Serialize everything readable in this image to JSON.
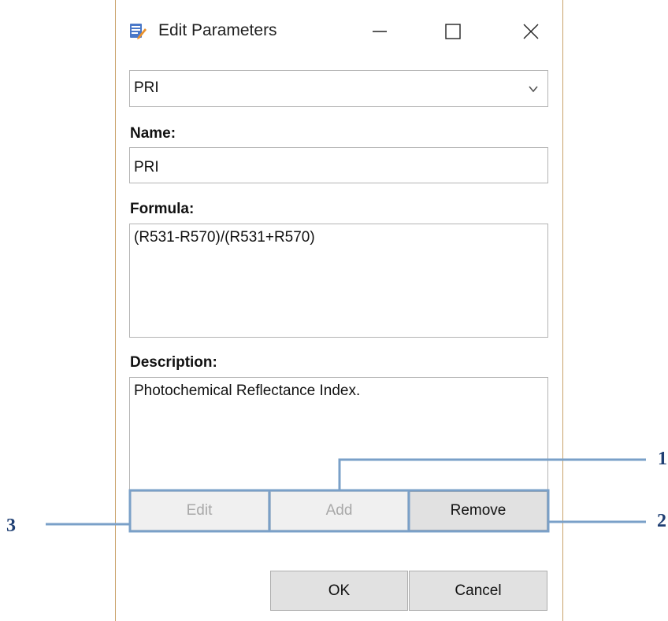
{
  "window": {
    "title": "Edit Parameters",
    "icon": "edit-document-icon",
    "controls": [
      "minimize-icon",
      "maximize-icon",
      "close-icon"
    ]
  },
  "parameter_select": {
    "value": "PRI"
  },
  "name": {
    "label": "Name:",
    "value": "PRI"
  },
  "formula": {
    "label": "Formula:",
    "value": "(R531-R570)/(R531+R570)"
  },
  "description": {
    "label": "Description:",
    "value": "Photochemical Reflectance Index."
  },
  "action_buttons": {
    "edit": {
      "label": "Edit",
      "enabled": false
    },
    "add": {
      "label": "Add",
      "enabled": false
    },
    "remove": {
      "label": "Remove",
      "enabled": true
    }
  },
  "dialog_buttons": {
    "ok": "OK",
    "cancel": "Cancel"
  },
  "annotations": {
    "callout_1": "1",
    "callout_2": "2",
    "callout_3": "3"
  },
  "colors": {
    "window_border": "#c9a26a",
    "callout_line": "#7aa0c8",
    "callout_text": "#1f3f73",
    "button_face": "#e1e1e1",
    "button_disabled": "#f0f0f0"
  }
}
